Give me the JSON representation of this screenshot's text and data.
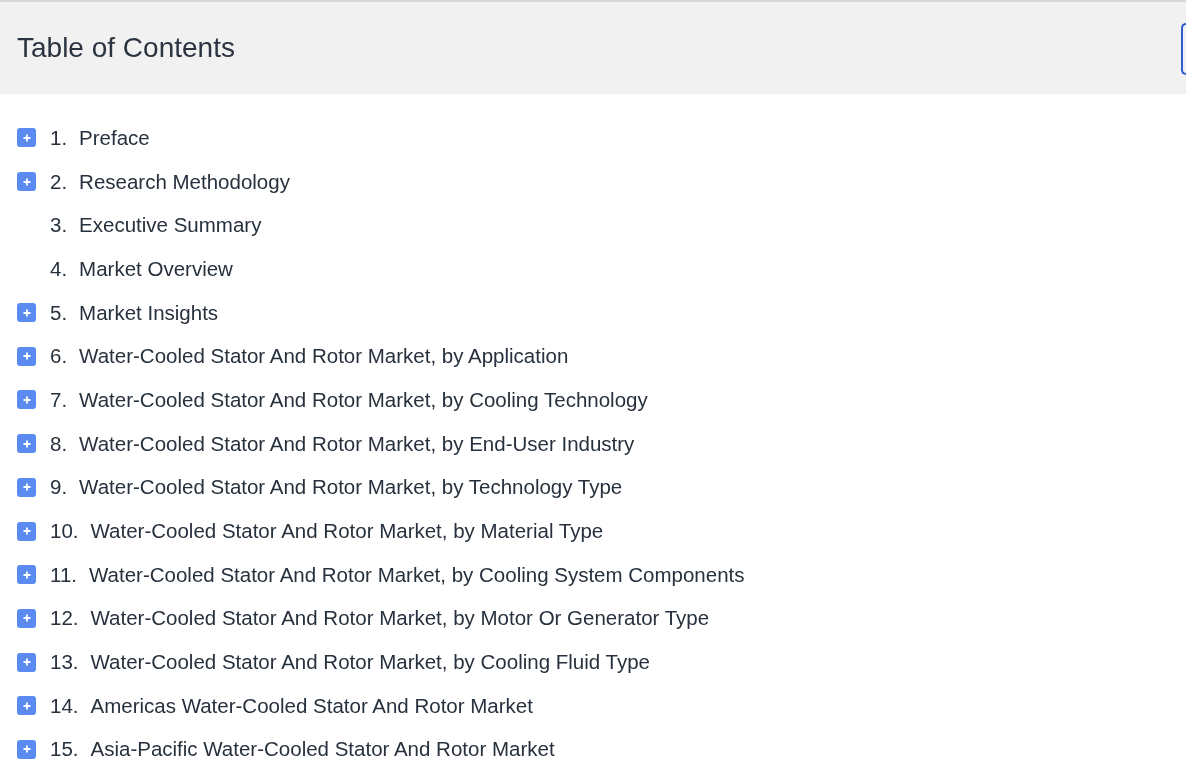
{
  "header": {
    "title": "Table of Contents"
  },
  "items": [
    {
      "number": "1.",
      "label": "Preface",
      "expandable": true
    },
    {
      "number": "2.",
      "label": "Research Methodology",
      "expandable": true
    },
    {
      "number": "3.",
      "label": "Executive Summary",
      "expandable": false
    },
    {
      "number": "4.",
      "label": "Market Overview",
      "expandable": false
    },
    {
      "number": "5.",
      "label": "Market Insights",
      "expandable": true
    },
    {
      "number": "6.",
      "label": "Water-Cooled Stator And Rotor Market, by Application",
      "expandable": true
    },
    {
      "number": "7.",
      "label": "Water-Cooled Stator And Rotor Market, by Cooling Technology",
      "expandable": true
    },
    {
      "number": "8.",
      "label": "Water-Cooled Stator And Rotor Market, by End-User Industry",
      "expandable": true
    },
    {
      "number": "9.",
      "label": "Water-Cooled Stator And Rotor Market, by Technology Type",
      "expandable": true
    },
    {
      "number": "10.",
      "label": "Water-Cooled Stator And Rotor Market, by Material Type",
      "expandable": true
    },
    {
      "number": "11.",
      "label": "Water-Cooled Stator And Rotor Market, by Cooling System Components",
      "expandable": true
    },
    {
      "number": "12.",
      "label": "Water-Cooled Stator And Rotor Market, by Motor Or Generator Type",
      "expandable": true
    },
    {
      "number": "13.",
      "label": "Water-Cooled Stator And Rotor Market, by Cooling Fluid Type",
      "expandable": true
    },
    {
      "number": "14.",
      "label": "Americas Water-Cooled Stator And Rotor Market",
      "expandable": true
    },
    {
      "number": "15.",
      "label": "Asia-Pacific Water-Cooled Stator And Rotor Market",
      "expandable": true
    }
  ]
}
